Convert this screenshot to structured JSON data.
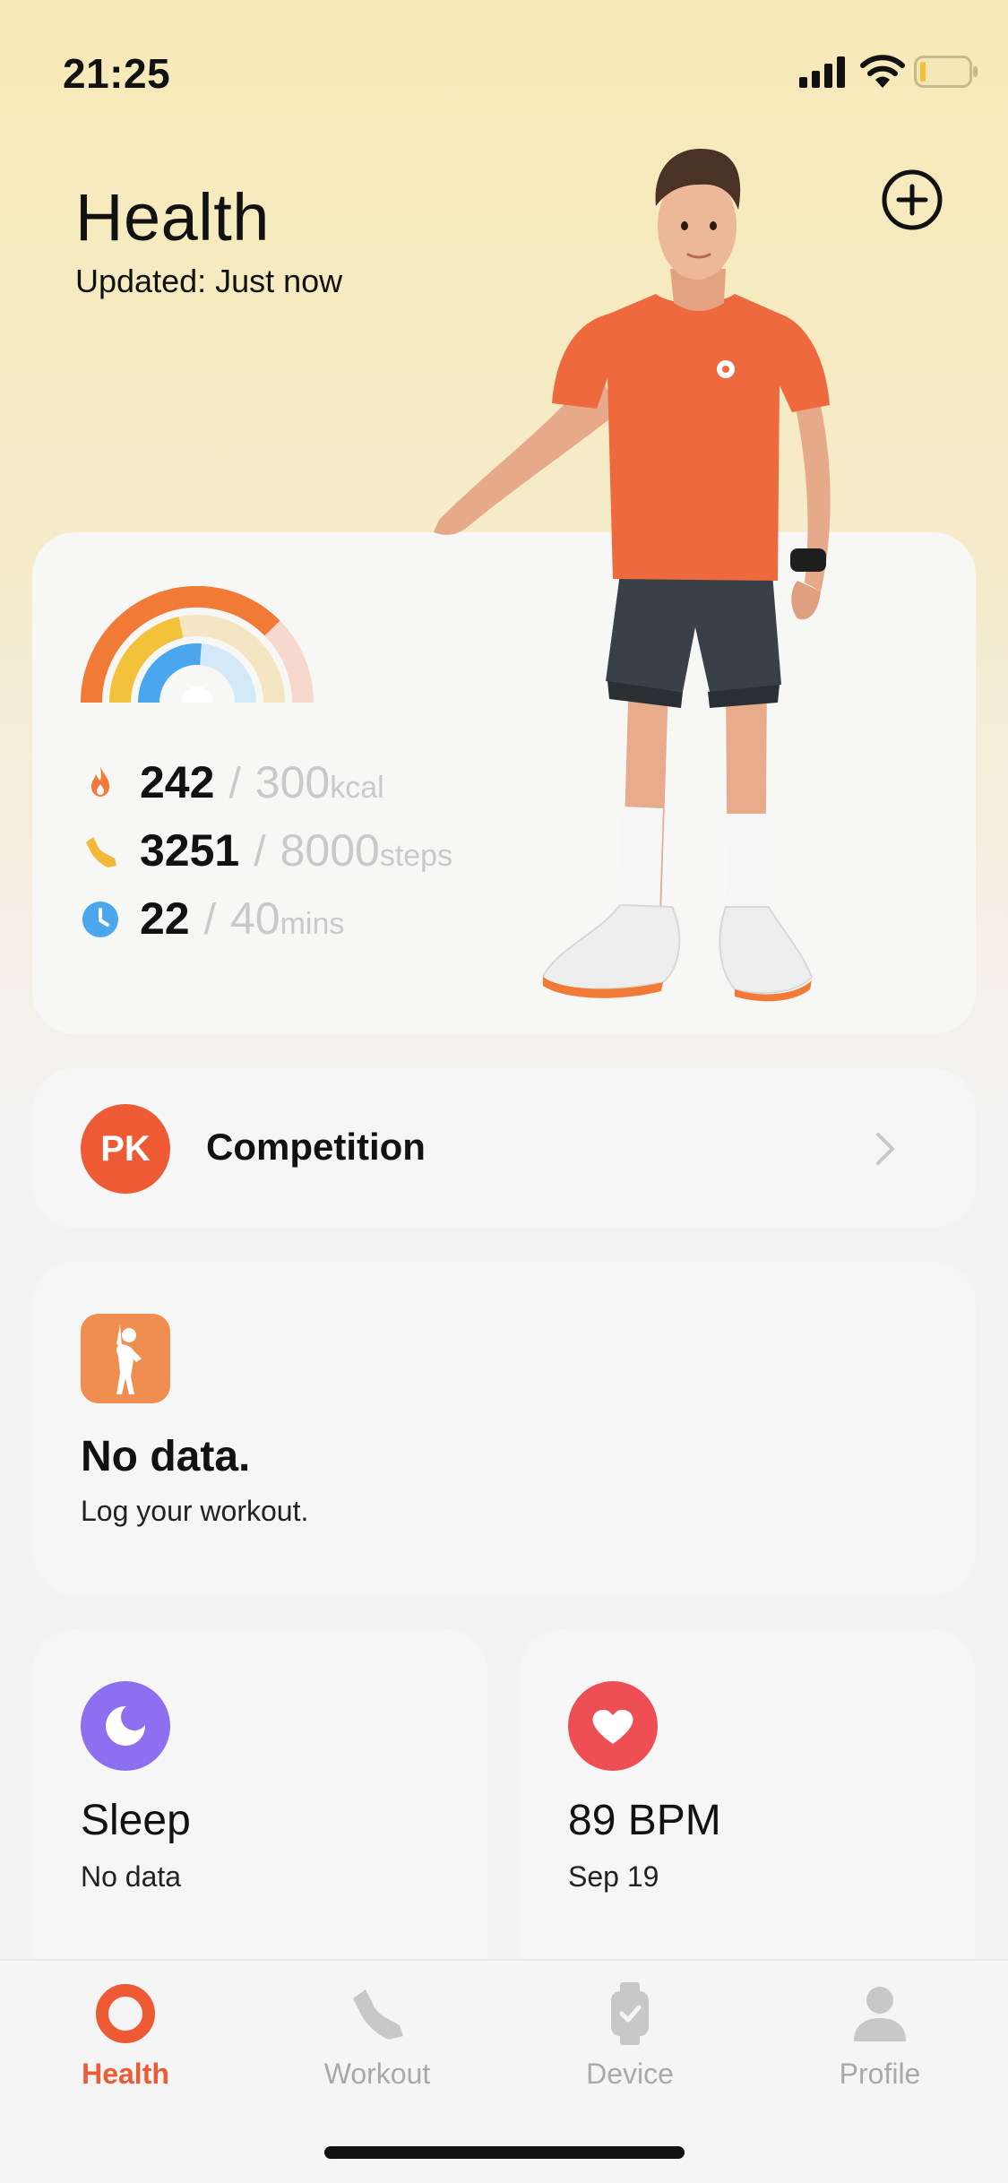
{
  "status_bar": {
    "time": "21:25"
  },
  "header": {
    "title": "Health",
    "subtitle": "Updated: Just now"
  },
  "summary": {
    "metrics": [
      {
        "icon": "flame-icon",
        "value": "242",
        "sep": "/",
        "goal": "300",
        "unit": "kcal",
        "color": "#f07a36"
      },
      {
        "icon": "shoe-icon",
        "value": "3251",
        "sep": "/",
        "goal": "8000",
        "unit": "steps",
        "color": "#f2b83a"
      },
      {
        "icon": "clock-icon",
        "value": "22",
        "sep": "/",
        "goal": "40",
        "unit": "mins",
        "color": "#4aa7ee"
      }
    ]
  },
  "competition": {
    "badge": "PK",
    "label": "Competition"
  },
  "workout": {
    "title": "No data.",
    "subtitle": "Log your workout."
  },
  "sleep": {
    "title": "Sleep",
    "subtitle": "No data"
  },
  "heart": {
    "title": "89 BPM",
    "subtitle": "Sep 19"
  },
  "tabs": [
    {
      "label": "Health",
      "icon": "ring-icon",
      "active": true
    },
    {
      "label": "Workout",
      "icon": "shoe-icon",
      "active": false
    },
    {
      "label": "Device",
      "icon": "watch-icon",
      "active": false
    },
    {
      "label": "Profile",
      "icon": "person-icon",
      "active": false
    }
  ],
  "colors": {
    "accent": "#ee5a33",
    "kcal": "#f07a36",
    "steps": "#f2b83a",
    "mins": "#4aa7ee"
  }
}
